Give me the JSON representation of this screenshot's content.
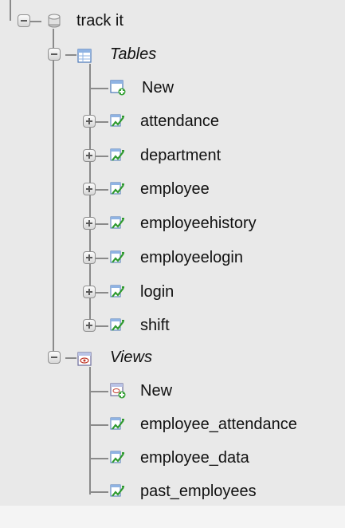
{
  "tree": {
    "database": {
      "name": "track it",
      "icon": "database-icon"
    },
    "tables": {
      "group_label": "Tables",
      "icon": "tables-icon",
      "new_label": "New",
      "items": [
        "attendance",
        "department",
        "employee",
        "employeehistory",
        "employeelogin",
        "login",
        "shift"
      ]
    },
    "views": {
      "group_label": "Views",
      "icon": "views-icon",
      "new_label": "New",
      "items": [
        "employee_attendance",
        "employee_data",
        "past_employees"
      ]
    }
  },
  "colors": {
    "background": "#e9e9e9",
    "tree_line": "#8a8a8a",
    "bottom_strip": "#f4f4f4"
  }
}
